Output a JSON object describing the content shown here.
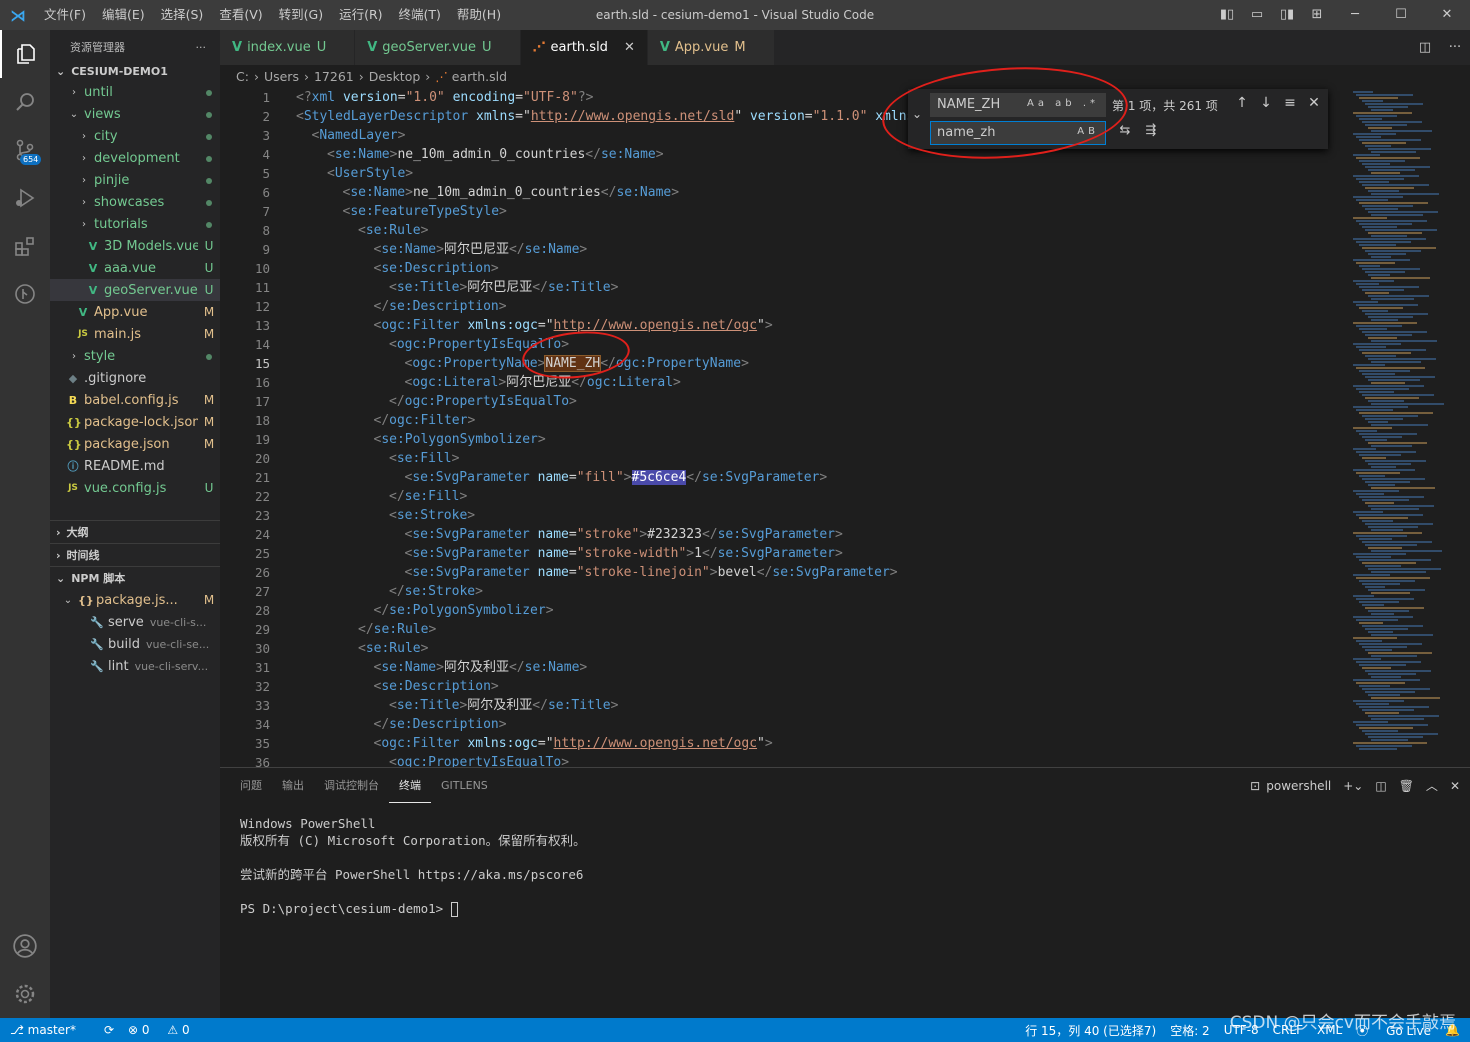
{
  "window": {
    "title": "earth.sld - cesium-demo1 - Visual Studio Code",
    "menu": [
      "文件(F)",
      "编辑(E)",
      "选择(S)",
      "查看(V)",
      "转到(G)",
      "运行(R)",
      "终端(T)",
      "帮助(H)"
    ]
  },
  "activity": {
    "scm_badge": "654"
  },
  "sidebar": {
    "header": "资源管理器",
    "project": "CESIUM-DEMO1",
    "items": [
      {
        "label": "until",
        "chev": "›",
        "indent": 1,
        "kind": "folder",
        "status": "dot"
      },
      {
        "label": "views",
        "chev": "⌄",
        "indent": 1,
        "kind": "folder",
        "status": "dot"
      },
      {
        "label": "city",
        "chev": "›",
        "indent": 2,
        "kind": "folder",
        "status": "dot"
      },
      {
        "label": "development",
        "chev": "›",
        "indent": 2,
        "kind": "folder",
        "status": "dot"
      },
      {
        "label": "pinjie",
        "chev": "›",
        "indent": 2,
        "kind": "folder",
        "status": "dot"
      },
      {
        "label": "showcases",
        "chev": "›",
        "indent": 2,
        "kind": "folder",
        "status": "dot"
      },
      {
        "label": "tutorials",
        "chev": "›",
        "indent": 2,
        "kind": "folder",
        "status": "dot"
      },
      {
        "label": "3D Models.vue",
        "chev": "",
        "indent": 2,
        "kind": "vue",
        "status": "U"
      },
      {
        "label": "aaa.vue",
        "chev": "",
        "indent": 2,
        "kind": "vue",
        "status": "U"
      },
      {
        "label": "geoServer.vue",
        "chev": "",
        "indent": 2,
        "kind": "vue",
        "status": "U",
        "selected": true
      },
      {
        "label": "App.vue",
        "chev": "",
        "indent": 1,
        "kind": "vue",
        "status": "M"
      },
      {
        "label": "main.js",
        "chev": "",
        "indent": 1,
        "kind": "js",
        "status": "M"
      },
      {
        "label": "style",
        "chev": "›",
        "indent": 1,
        "kind": "folder",
        "status": "dot"
      },
      {
        "label": ".gitignore",
        "chev": "",
        "indent": 0,
        "kind": "git",
        "status": ""
      },
      {
        "label": "babel.config.js",
        "chev": "",
        "indent": 0,
        "kind": "babel",
        "status": "M"
      },
      {
        "label": "package-lock.json",
        "chev": "",
        "indent": 0,
        "kind": "json",
        "status": "M"
      },
      {
        "label": "package.json",
        "chev": "",
        "indent": 0,
        "kind": "json",
        "status": "M"
      },
      {
        "label": "README.md",
        "chev": "",
        "indent": 0,
        "kind": "info",
        "status": ""
      },
      {
        "label": "vue.config.js",
        "chev": "",
        "indent": 0,
        "kind": "js",
        "status": "U"
      }
    ],
    "sections": {
      "outline": "大纲",
      "timeline": "时间线",
      "npm": "NPM 脚本",
      "npm_pkg": "package.js...",
      "npm_pkg_status": "M",
      "scripts": [
        {
          "name": "serve",
          "cmd": "vue-cli-s..."
        },
        {
          "name": "build",
          "cmd": "vue-cli-se..."
        },
        {
          "name": "lint",
          "cmd": "vue-cli-serv..."
        }
      ]
    }
  },
  "tabs": [
    {
      "label": "index.vue",
      "status": "U",
      "kind": "vue"
    },
    {
      "label": "geoServer.vue",
      "status": "U",
      "kind": "vue"
    },
    {
      "label": "earth.sld",
      "status": "",
      "kind": "sld",
      "active": true
    },
    {
      "label": "App.vue",
      "status": "M",
      "kind": "vue"
    }
  ],
  "breadcrumb": [
    "C:",
    "Users",
    "17261",
    "Desktop",
    "earth.sld"
  ],
  "find": {
    "find_value": "NAME_ZH",
    "replace_value": "name_zh",
    "find_opts": "Aa ab .*",
    "replace_opts": "AB",
    "count": "第 1 项，共 261 项"
  },
  "editor": {
    "current_line": 15,
    "first_line": 1
  },
  "panel": {
    "tabs": [
      "问题",
      "输出",
      "调试控制台",
      "终端",
      "GITLENS"
    ],
    "active_tab": "终端",
    "shell": "powershell",
    "terminal": [
      "Windows PowerShell",
      "版权所有 (C) Microsoft Corporation。保留所有权利。",
      "",
      "尝试新的跨平台 PowerShell https://aka.ms/pscore6",
      "",
      "PS D:\\project\\cesium-demo1> "
    ]
  },
  "status": {
    "branch": "master*",
    "errors": "0",
    "warnings": "0",
    "position": "行 15，列 40 (已选择7)",
    "spaces": "空格: 2",
    "encoding": "UTF-8",
    "eol": "CRLF",
    "language": "XML",
    "golive": "Go Live",
    "watermark": "CSDN @只会cv而不会手敲焉"
  }
}
